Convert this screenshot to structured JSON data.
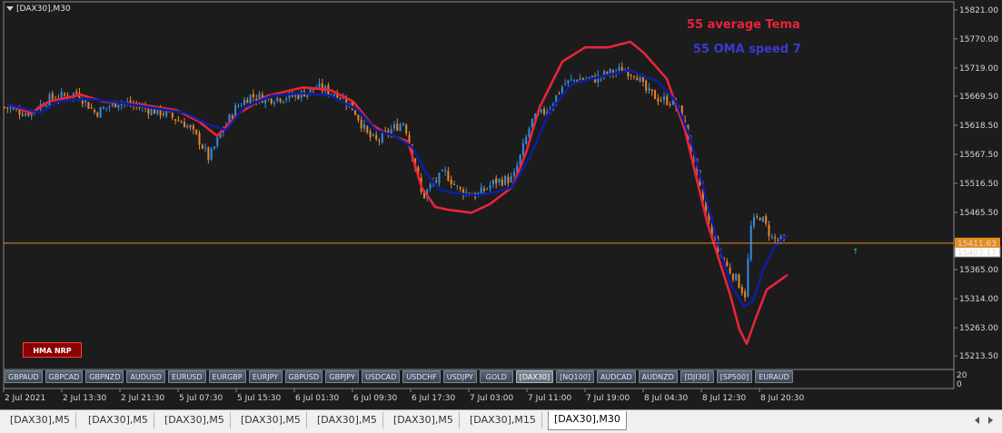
{
  "chart": {
    "title": "[DAX30],M30",
    "legend_tema": "55 average Tema",
    "legend_oma": "55 OMA speed 7",
    "current_price": "15403.17",
    "orange_line_label": "15411.63",
    "colors": {
      "background": "#1c1c1c",
      "tema": "#e8243c",
      "oma": "#0d1fa0",
      "bull": "#2d8fe8",
      "bear": "#e8862d",
      "hline": "#e88a1c"
    }
  },
  "chart_data": {
    "type": "candlestick",
    "title": "[DAX30],M30",
    "ylim": [
      15190,
      15835
    ],
    "y_ticks": [
      15821,
      15770,
      15719,
      15669.5,
      15618.5,
      15567.5,
      15516.5,
      15465.5,
      15414.5,
      15365,
      15314,
      15263,
      15213.5
    ],
    "y_tick_labels": [
      "15821.00",
      "15770.00",
      "15719.00",
      "15669.50",
      "15618.50",
      "15567.50",
      "15516.50",
      "15465.50",
      "15414.50",
      "15365.00",
      "15314.00",
      "15263.00",
      "15213.50"
    ],
    "x_tick_labels": [
      "2 Jul 2021",
      "2 Jul 13:30",
      "2 Jul 21:30",
      "5 Jul 07:30",
      "5 Jul 15:30",
      "6 Jul 01:30",
      "6 Jul 09:30",
      "6 Jul 17:30",
      "7 Jul 03:00",
      "7 Jul 11:00",
      "7 Jul 19:00",
      "8 Jul 04:30",
      "8 Jul 12:30",
      "8 Jul 20:30"
    ],
    "indicator_labels": [
      "20",
      "0"
    ],
    "close_anchors": [
      [
        0,
        15650
      ],
      [
        25,
        15640
      ],
      [
        50,
        15665
      ],
      [
        80,
        15675
      ],
      [
        100,
        15640
      ],
      [
        125,
        15660
      ],
      [
        150,
        15650
      ],
      [
        175,
        15640
      ],
      [
        200,
        15620
      ],
      [
        215,
        15590
      ],
      [
        225,
        15560
      ],
      [
        240,
        15610
      ],
      [
        255,
        15650
      ],
      [
        270,
        15670
      ],
      [
        290,
        15665
      ],
      [
        320,
        15670
      ],
      [
        345,
        15685
      ],
      [
        370,
        15670
      ],
      [
        385,
        15645
      ],
      [
        400,
        15600
      ],
      [
        410,
        15590
      ],
      [
        425,
        15610
      ],
      [
        440,
        15625
      ],
      [
        450,
        15560
      ],
      [
        460,
        15490
      ],
      [
        470,
        15515
      ],
      [
        485,
        15535
      ],
      [
        500,
        15505
      ],
      [
        520,
        15495
      ],
      [
        540,
        15520
      ],
      [
        560,
        15525
      ],
      [
        570,
        15575
      ],
      [
        580,
        15625
      ],
      [
        600,
        15650
      ],
      [
        615,
        15690
      ],
      [
        630,
        15700
      ],
      [
        650,
        15700
      ],
      [
        665,
        15710
      ],
      [
        680,
        15715
      ],
      [
        695,
        15710
      ],
      [
        705,
        15680
      ],
      [
        720,
        15665
      ],
      [
        735,
        15660
      ],
      [
        745,
        15640
      ],
      [
        755,
        15580
      ],
      [
        765,
        15510
      ],
      [
        775,
        15450
      ],
      [
        785,
        15400
      ],
      [
        795,
        15370
      ],
      [
        805,
        15350
      ],
      [
        815,
        15320
      ],
      [
        822,
        15445
      ],
      [
        832,
        15460
      ],
      [
        845,
        15420
      ],
      [
        860,
        15412
      ]
    ],
    "series": [
      {
        "name": "55 average Tema",
        "points": [
          [
            5,
            15655
          ],
          [
            30,
            15640
          ],
          [
            50,
            15660
          ],
          [
            85,
            15672
          ],
          [
            110,
            15660
          ],
          [
            150,
            15655
          ],
          [
            190,
            15645
          ],
          [
            215,
            15625
          ],
          [
            235,
            15600
          ],
          [
            260,
            15640
          ],
          [
            290,
            15670
          ],
          [
            330,
            15685
          ],
          [
            360,
            15680
          ],
          [
            385,
            15660
          ],
          [
            405,
            15620
          ],
          [
            420,
            15605
          ],
          [
            445,
            15590
          ],
          [
            460,
            15510
          ],
          [
            475,
            15475
          ],
          [
            490,
            15470
          ],
          [
            515,
            15465
          ],
          [
            535,
            15480
          ],
          [
            560,
            15510
          ],
          [
            575,
            15570
          ],
          [
            590,
            15650
          ],
          [
            615,
            15730
          ],
          [
            640,
            15755
          ],
          [
            665,
            15755
          ],
          [
            690,
            15765
          ],
          [
            705,
            15745
          ],
          [
            730,
            15700
          ],
          [
            750,
            15610
          ],
          [
            765,
            15510
          ],
          [
            775,
            15445
          ],
          [
            785,
            15395
          ],
          [
            800,
            15320
          ],
          [
            810,
            15260
          ],
          [
            818,
            15235
          ],
          [
            828,
            15280
          ],
          [
            840,
            15330
          ],
          [
            862,
            15355
          ]
        ]
      },
      {
        "name": "55 OMA speed 7",
        "points": [
          [
            5,
            15655
          ],
          [
            40,
            15640
          ],
          [
            60,
            15660
          ],
          [
            90,
            15665
          ],
          [
            120,
            15660
          ],
          [
            160,
            15650
          ],
          [
            200,
            15640
          ],
          [
            225,
            15620
          ],
          [
            245,
            15610
          ],
          [
            265,
            15650
          ],
          [
            295,
            15670
          ],
          [
            330,
            15675
          ],
          [
            360,
            15670
          ],
          [
            390,
            15645
          ],
          [
            410,
            15610
          ],
          [
            430,
            15600
          ],
          [
            450,
            15580
          ],
          [
            465,
            15535
          ],
          [
            480,
            15505
          ],
          [
            495,
            15500
          ],
          [
            520,
            15495
          ],
          [
            540,
            15500
          ],
          [
            560,
            15510
          ],
          [
            580,
            15565
          ],
          [
            600,
            15640
          ],
          [
            625,
            15690
          ],
          [
            660,
            15705
          ],
          [
            690,
            15715
          ],
          [
            720,
            15695
          ],
          [
            740,
            15660
          ],
          [
            755,
            15600
          ],
          [
            770,
            15510
          ],
          [
            785,
            15420
          ],
          [
            800,
            15340
          ],
          [
            815,
            15300
          ],
          [
            825,
            15310
          ],
          [
            835,
            15360
          ],
          [
            848,
            15405
          ],
          [
            862,
            15425
          ]
        ]
      }
    ]
  },
  "symbol_buttons": [
    "GBPAUD",
    "GBPCAD",
    "GBPNZD",
    "AUDUSD",
    "EURUSD",
    "EURGBP",
    "EURJPY",
    "GBPUSD",
    "GBPJPY",
    "USDCAD",
    "USDCHF",
    "USDJPY",
    "GOLD",
    "[DAX30]",
    "[NQ100]",
    "AUDCAD",
    "AUDNZD",
    "[DJI30]",
    "[SP500]",
    "EURAUD"
  ],
  "active_symbol_index": 13,
  "hma_button": "HMA NRP",
  "tabs": [
    "[DAX30],M5",
    "[DAX30],M5",
    "[DAX30],M5",
    "[DAX30],M5",
    "[DAX30],M5",
    "[DAX30],M5",
    "[DAX30],M15",
    "[DAX30],M30"
  ],
  "active_tab_index": 7
}
